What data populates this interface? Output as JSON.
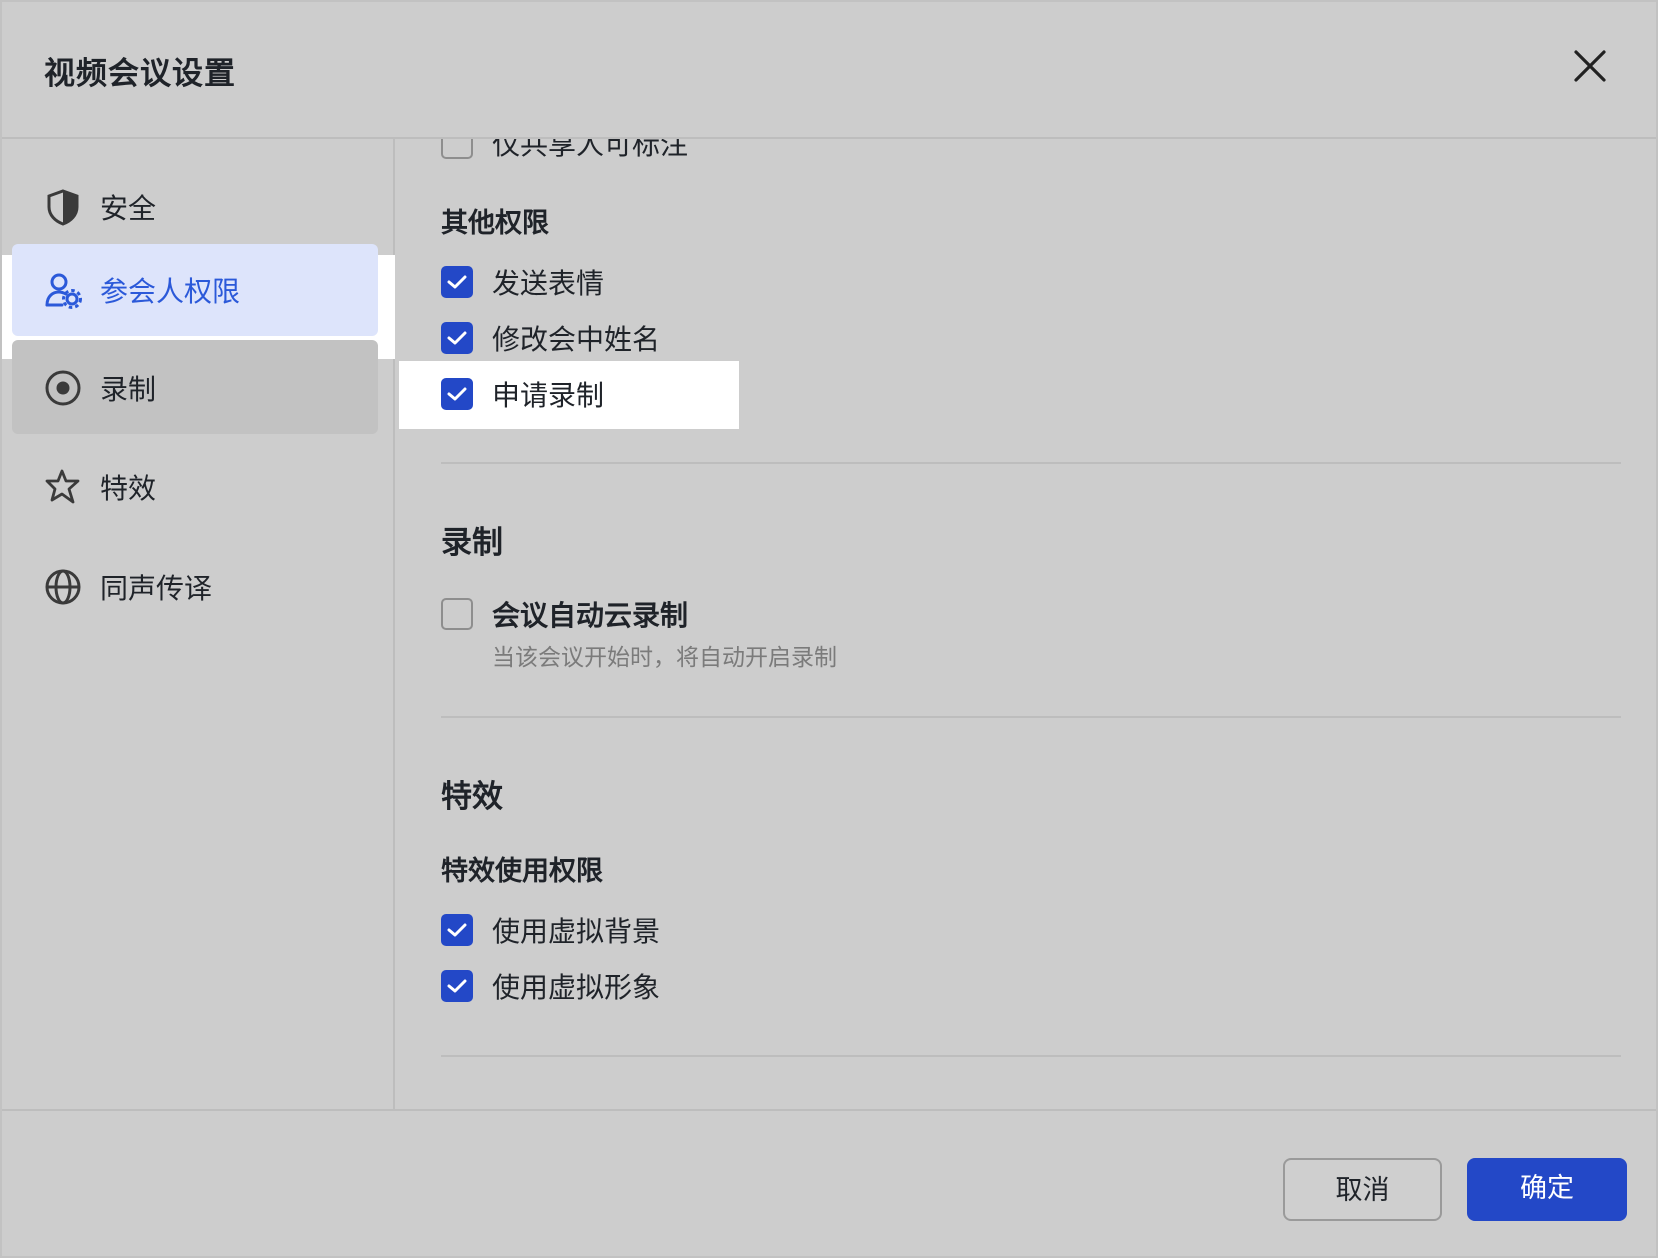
{
  "dialog": {
    "title": "视频会议设置"
  },
  "sidebar": {
    "items": [
      {
        "label": "安全",
        "icon": "shield-icon"
      },
      {
        "label": "参会人权限",
        "icon": "user-settings-icon",
        "active": true
      },
      {
        "label": "录制",
        "icon": "record-icon"
      },
      {
        "label": "特效",
        "icon": "sparkle-star-icon"
      },
      {
        "label": "同声传译",
        "icon": "globe-icon"
      }
    ]
  },
  "content": {
    "partial_option": {
      "label": "仅共享人可标注",
      "checked": false
    },
    "other_permissions": {
      "heading": "其他权限",
      "options": [
        {
          "label": "发送表情",
          "checked": true
        },
        {
          "label": "修改会中姓名",
          "checked": true
        },
        {
          "label": "申请录制",
          "checked": true
        }
      ]
    },
    "recording": {
      "heading": "录制",
      "option": {
        "label": "会议自动云录制",
        "checked": false,
        "description": "当该会议开始时，将自动开启录制"
      }
    },
    "effects": {
      "heading": "特效",
      "subheading": "特效使用权限",
      "options": [
        {
          "label": "使用虚拟背景",
          "checked": true
        },
        {
          "label": "使用虚拟形象",
          "checked": true
        }
      ]
    }
  },
  "footer": {
    "cancel_label": "取消",
    "ok_label": "确定"
  },
  "colors": {
    "accent": "#2348c7",
    "active_text": "#2b59d9",
    "active_bg": "#dde4fb",
    "backdrop": "#cdcdcd"
  }
}
